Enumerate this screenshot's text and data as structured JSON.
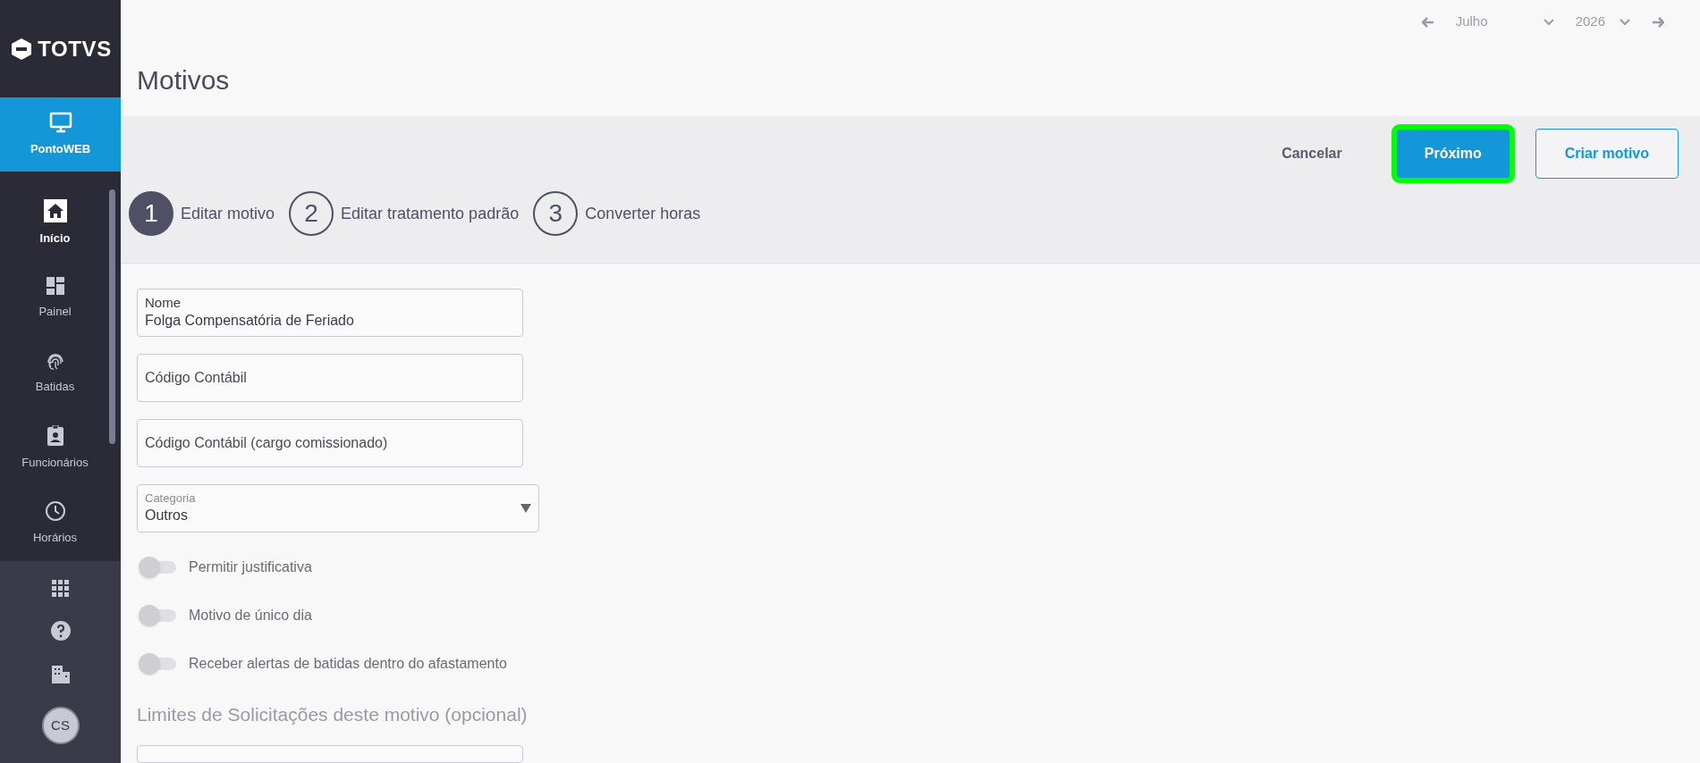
{
  "sidebar": {
    "logo": "TOTVS",
    "app": {
      "label": "PontoWEB",
      "selected": true
    },
    "items": [
      {
        "label": "Início",
        "kind": "home",
        "selected": true
      },
      {
        "label": "Painel",
        "kind": "dashboard",
        "selected": false
      },
      {
        "label": "Batidas",
        "kind": "fingerprint",
        "selected": false
      },
      {
        "label": "Funcionários",
        "kind": "badge",
        "selected": false
      },
      {
        "label": "Horários",
        "kind": "clock",
        "selected": false
      }
    ],
    "avatar": "CS"
  },
  "period": {
    "month": "Julho",
    "year": "2026"
  },
  "title": "Motivos",
  "actions": [
    {
      "label": "Cancelar",
      "kind": "text",
      "highlighted": false
    },
    {
      "label": "Próximo",
      "kind": "primary",
      "highlighted": true
    },
    {
      "label": "Criar motivo",
      "kind": "outline",
      "highlighted": false
    }
  ],
  "steps": [
    {
      "number": "1",
      "label": "Editar motivo",
      "selected": true
    },
    {
      "number": "2",
      "label": "Editar tratamento padrão",
      "selected": false
    },
    {
      "number": "3",
      "label": "Converter horas",
      "selected": false
    }
  ],
  "fields": [
    {
      "kind": "text",
      "label": "Nome",
      "value": "Folga Compensatória de Feriado"
    },
    {
      "kind": "text",
      "placeholder": "Código Contábil"
    },
    {
      "kind": "text",
      "placeholder": "Código Contábil (cargo comissionado)"
    },
    {
      "kind": "select",
      "label": "Categoria",
      "value": "Outros"
    }
  ],
  "toggles": [
    {
      "label": "Permitir justificativa",
      "on": false
    },
    {
      "label": "Motivo de único dia",
      "on": false
    },
    {
      "label": "Receber alertas de batidas dentro do afastamento",
      "on": false
    }
  ],
  "limits_heading": "Limites de Solicitações deste motivo (opcional)"
}
